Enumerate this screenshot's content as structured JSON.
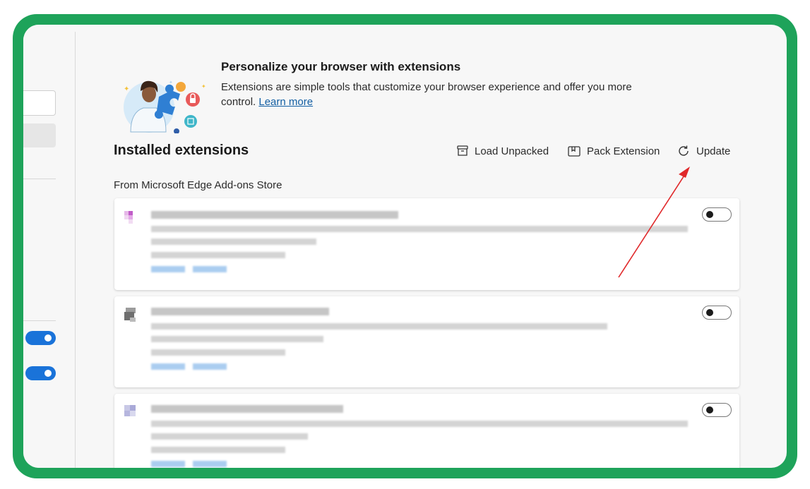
{
  "hero": {
    "title": "Personalize your browser with extensions",
    "description": "Extensions are simple tools that customize your browser experience and offer you more control.",
    "learn_more": "Learn more"
  },
  "installed": {
    "title": "Installed extensions",
    "load_unpacked": "Load Unpacked",
    "pack_extension": "Pack Extension",
    "update": "Update",
    "source_label": "From Microsoft Edge Add-ons Store"
  },
  "extensions": [
    {
      "enabled": false,
      "details": "blurred"
    },
    {
      "enabled": false,
      "details": "blurred"
    },
    {
      "enabled": false,
      "details": "blurred"
    }
  ],
  "sidebar": {
    "toggles": [
      {
        "enabled": true
      },
      {
        "enabled": true
      }
    ]
  },
  "colors": {
    "frame": "#1ea35a",
    "accent": "#1a73d9",
    "link": "#115ea3",
    "annotation_arrow": "#e0282a"
  }
}
